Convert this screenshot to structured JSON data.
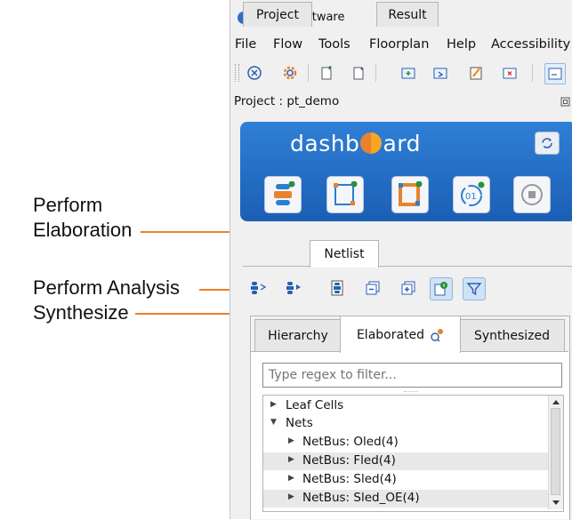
{
  "callouts": {
    "perform": "Perform",
    "elaboration": "Elaboration",
    "perform_analysis": "Perform Analysis",
    "synthesize": "Synthesize",
    "line_color": "#e8822e"
  },
  "window": {
    "title": "Efinity Software",
    "menu": [
      "File",
      "Flow",
      "Tools",
      "Floorplan",
      "Help",
      "Accessibility"
    ],
    "toolbar_icons": [
      "close-circle-icon",
      "settings-gear-icon",
      "new-file-icon",
      "open-file-icon",
      "add-folder-icon",
      "import-folder-icon",
      "edit-file-icon",
      "remove-file-icon",
      "console-icon"
    ],
    "project_label": "Project : pt_demo"
  },
  "dashboard": {
    "title_left": "dashb",
    "title_right": "ard",
    "buttons": [
      "synthesize-icon",
      "floorplan-icon",
      "place-route-icon",
      "bitstream-icon",
      "stop-icon"
    ],
    "color": "#2f7fd6"
  },
  "tabs": [
    "Project",
    "Netlist",
    "Result"
  ],
  "active_tab": "Netlist",
  "netlist_toolbar": [
    "perform-elaboration-icon",
    "perform-analysis-icon",
    "synthesize-icon",
    "collapse-all-icon",
    "expand-all-icon",
    "info-icon",
    "filter-icon"
  ],
  "subtabs": [
    "Hierarchy",
    "Elaborated",
    "Synthesized"
  ],
  "active_subtab": "Elaborated",
  "filter": {
    "placeholder": "Type regex to filter..."
  },
  "tree": [
    {
      "label": "Leaf Cells",
      "level": 0,
      "expanded": false
    },
    {
      "label": "Nets",
      "level": 0,
      "expanded": true
    },
    {
      "label": "NetBus: Oled(4)",
      "level": 1,
      "expanded": false
    },
    {
      "label": "NetBus: Fled(4)",
      "level": 1,
      "expanded": false
    },
    {
      "label": "NetBus: Sled(4)",
      "level": 1,
      "expanded": false
    },
    {
      "label": "NetBus: Sled_OE(4)",
      "level": 1,
      "expanded": false
    }
  ]
}
